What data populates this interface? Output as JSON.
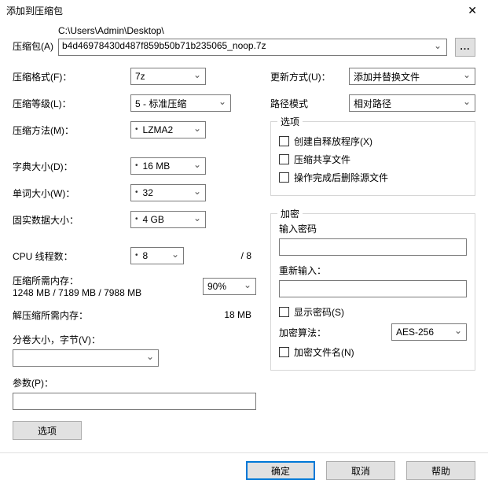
{
  "window": {
    "title": "添加到压缩包"
  },
  "archive": {
    "label": "压缩包(A)",
    "path_hint": "C:\\Users\\Admin\\Desktop\\",
    "filename": "b4d46978430d487f859b50b71b235065_noop.7z",
    "browse": "..."
  },
  "left": {
    "format_label": "压缩格式(F)：",
    "format_value": "7z",
    "level_label": "压缩等级(L)：",
    "level_value": "5 - 标准压缩",
    "method_label": "压缩方法(M)：",
    "method_value": "LZMA2",
    "dict_label": "字典大小(D)：",
    "dict_value": "16 MB",
    "word_label": "单词大小(W)：",
    "word_value": "32",
    "solid_label": "固实数据大小：",
    "solid_value": "4 GB",
    "threads_label": "CPU 线程数：",
    "threads_value": "8",
    "threads_total": "/ 8",
    "mem_comp_label": "压缩所需内存：",
    "mem_comp_detail": "1248 MB / 7189 MB / 7988 MB",
    "mem_pct": "90%",
    "mem_decomp_label": "解压缩所需内存：",
    "mem_decomp_value": "18 MB",
    "split_label": "分卷大小，字节(V)：",
    "params_label": "参数(P)：",
    "options_btn": "选项"
  },
  "right": {
    "update_label": "更新方式(U)：",
    "update_value": "添加并替换文件",
    "pathmode_label": "路径模式",
    "pathmode_value": "相对路径",
    "options_group": "选项",
    "opt_sfx": "创建自释放程序(X)",
    "opt_shared": "压缩共享文件",
    "opt_delete": "操作完成后删除源文件",
    "enc_group": "加密",
    "pwd_label": "输入密码",
    "pwd2_label": "重新输入：",
    "show_pwd": "显示密码(S)",
    "enc_method_label": "加密算法：",
    "enc_method_value": "AES-256",
    "enc_names": "加密文件名(N)"
  },
  "footer": {
    "ok": "确定",
    "cancel": "取消",
    "help": "帮助"
  }
}
